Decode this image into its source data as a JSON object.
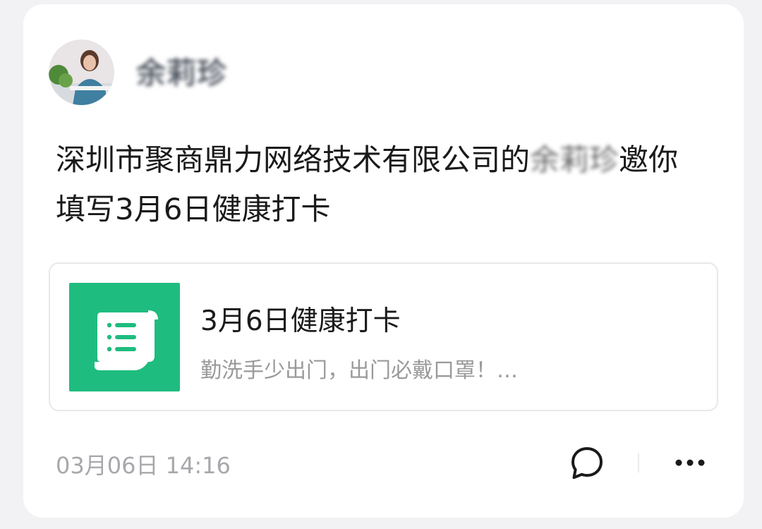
{
  "post": {
    "author_name": "余莉珍",
    "message_line1": "深圳市聚商鼎力网络技术有限公司的",
    "message_name": "余莉珍",
    "message_line1_end": "邀你",
    "message_line2": "填写3月6日健康打卡",
    "timestamp": "03月06日 14:16"
  },
  "share_card": {
    "title": "3月6日健康打卡",
    "description": "勤洗手少出门，出门必戴口罩！…",
    "icon": "scroll-list-icon",
    "icon_color": "#1fbc7f"
  },
  "actions": {
    "comment_icon": "comment-bubble-icon",
    "more_icon": "more-dots-icon"
  }
}
